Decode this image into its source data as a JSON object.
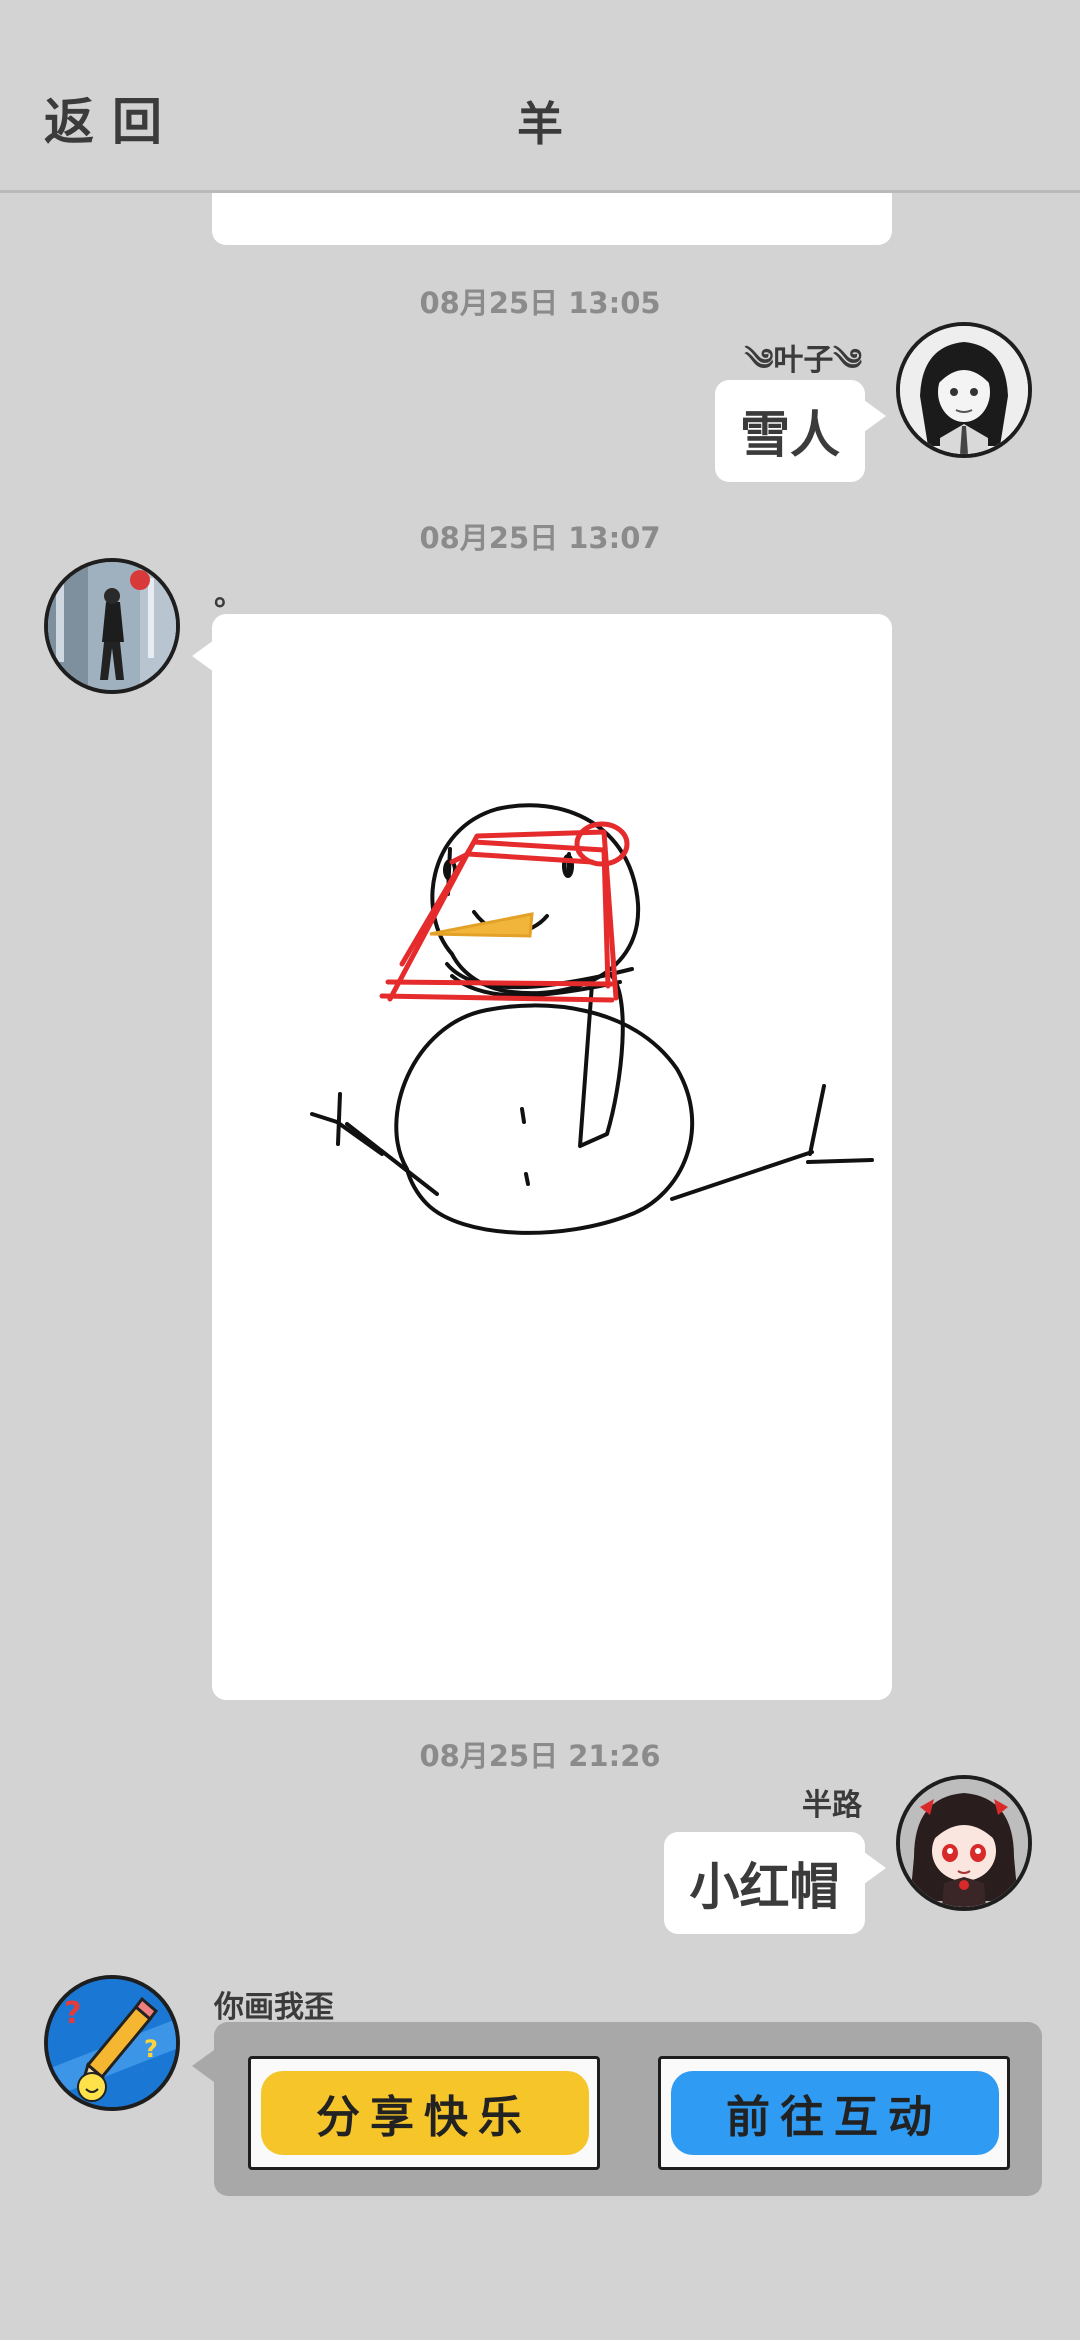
{
  "header": {
    "back_label": "返回",
    "title": "羊"
  },
  "messages": {
    "ts1": "08月25日  13:05",
    "m1_sender": "༄叶子༄",
    "m1_text": "雪人",
    "ts2": "08月25日  13:07",
    "m2_text": "。",
    "ts3": "08月25日  21:26",
    "m3_sender": "半路",
    "m3_text": "小红帽",
    "m4_sender": "你画我歪",
    "game_share_label": "分享快乐",
    "game_goto_label": "前往互动"
  },
  "colors": {
    "background": "#d3d3d3",
    "share_button": "#f5c52a",
    "goto_button": "#2f9bf2",
    "hat": "#e52b2b",
    "nose": "#f0b53a"
  }
}
